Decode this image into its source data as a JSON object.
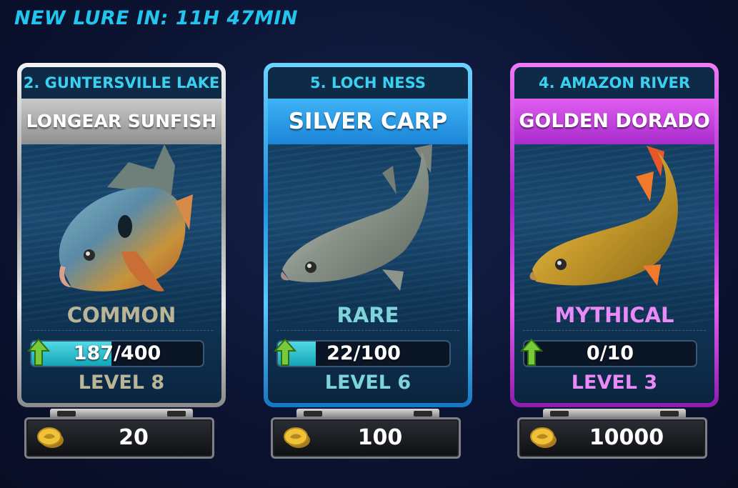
{
  "banner": "NEW LURE IN: 11H 47MIN",
  "colors": {
    "common": "#b9b596",
    "rare": "#7fd4d9",
    "mythical": "#e98af7",
    "accent": "#21c6ef"
  },
  "cards": [
    {
      "location": "2. GUNTERSVILLE LAKE",
      "fish": "LONGEAR SUNFISH",
      "rarity": "COMMON",
      "progress_text": "187/400",
      "progress": 0.4675,
      "level": "LEVEL 8",
      "price": "20",
      "icon": "sunfish-icon"
    },
    {
      "location": "5. LOCH NESS",
      "fish": "SILVER CARP",
      "rarity": "RARE",
      "progress_text": "22/100",
      "progress": 0.22,
      "level": "LEVEL 6",
      "price": "100",
      "icon": "carp-icon"
    },
    {
      "location": "4. AMAZON RIVER",
      "fish": "GOLDEN DORADO",
      "rarity": "MYTHICAL",
      "progress_text": "0/10",
      "progress": 0.0,
      "level": "LEVEL 3",
      "price": "10000",
      "icon": "dorado-icon"
    }
  ]
}
